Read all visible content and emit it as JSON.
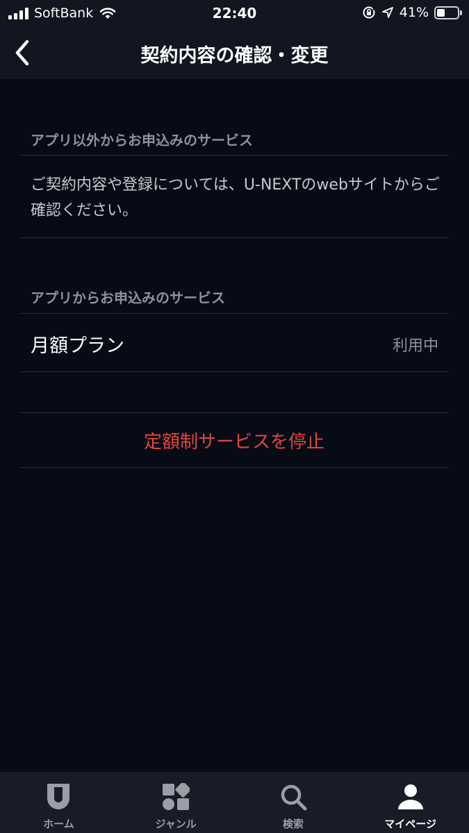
{
  "status_bar": {
    "carrier": "SoftBank",
    "time": "22:40",
    "battery": "41%",
    "battery_level": 0.41
  },
  "nav": {
    "title": "契約内容の確認・変更"
  },
  "section_other": {
    "header": "アプリ以外からお申込みのサービス",
    "body": "ご契約内容や登録については、U-NEXTのwebサイトからご確認ください。"
  },
  "section_app": {
    "header": "アプリからお申込みのサービス",
    "plan_name": "月額プラン",
    "plan_status": "利用中"
  },
  "actions": {
    "stop_label": "定額制サービスを停止"
  },
  "tabs": [
    {
      "label": "ホーム",
      "icon": "home-shield-icon"
    },
    {
      "label": "ジャンル",
      "icon": "genre-grid-icon"
    },
    {
      "label": "検索",
      "icon": "search-icon"
    },
    {
      "label": "マイページ",
      "icon": "person-icon"
    }
  ],
  "colors": {
    "background": "#060b16",
    "bar": "#121620",
    "accent_red": "#e2463d",
    "muted": "#8e939b"
  }
}
